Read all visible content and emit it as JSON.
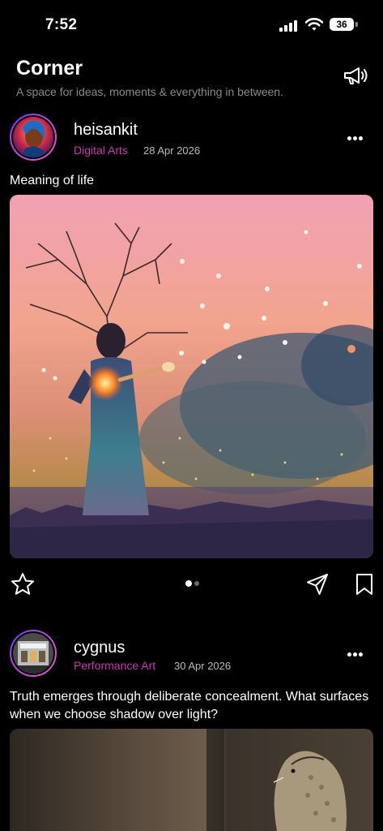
{
  "status": {
    "time": "7:52",
    "battery": "36",
    "signal_icon": "cellular-signal-icon",
    "wifi_icon": "wifi-icon"
  },
  "header": {
    "title": "Corner",
    "subtitle": "A space for ideas, moments & everything in between.",
    "action_icon": "megaphone-icon"
  },
  "posts": [
    {
      "username": "heisankit",
      "category": "Digital Arts",
      "date": "28 Apr 2026",
      "caption": "Meaning of life",
      "carousel_pages": 2,
      "carousel_current": 1
    },
    {
      "username": "cygnus",
      "category": "Performance Art",
      "date": "30 Apr 2026",
      "caption": "Truth emerges through deliberate concealment. What surfaces when we choose shadow over light?"
    }
  ],
  "colors": {
    "background": "#000000",
    "category": "#c63ab2",
    "muted_text": "#8a8a8a",
    "avatar_ring": "#9a3cf0"
  }
}
